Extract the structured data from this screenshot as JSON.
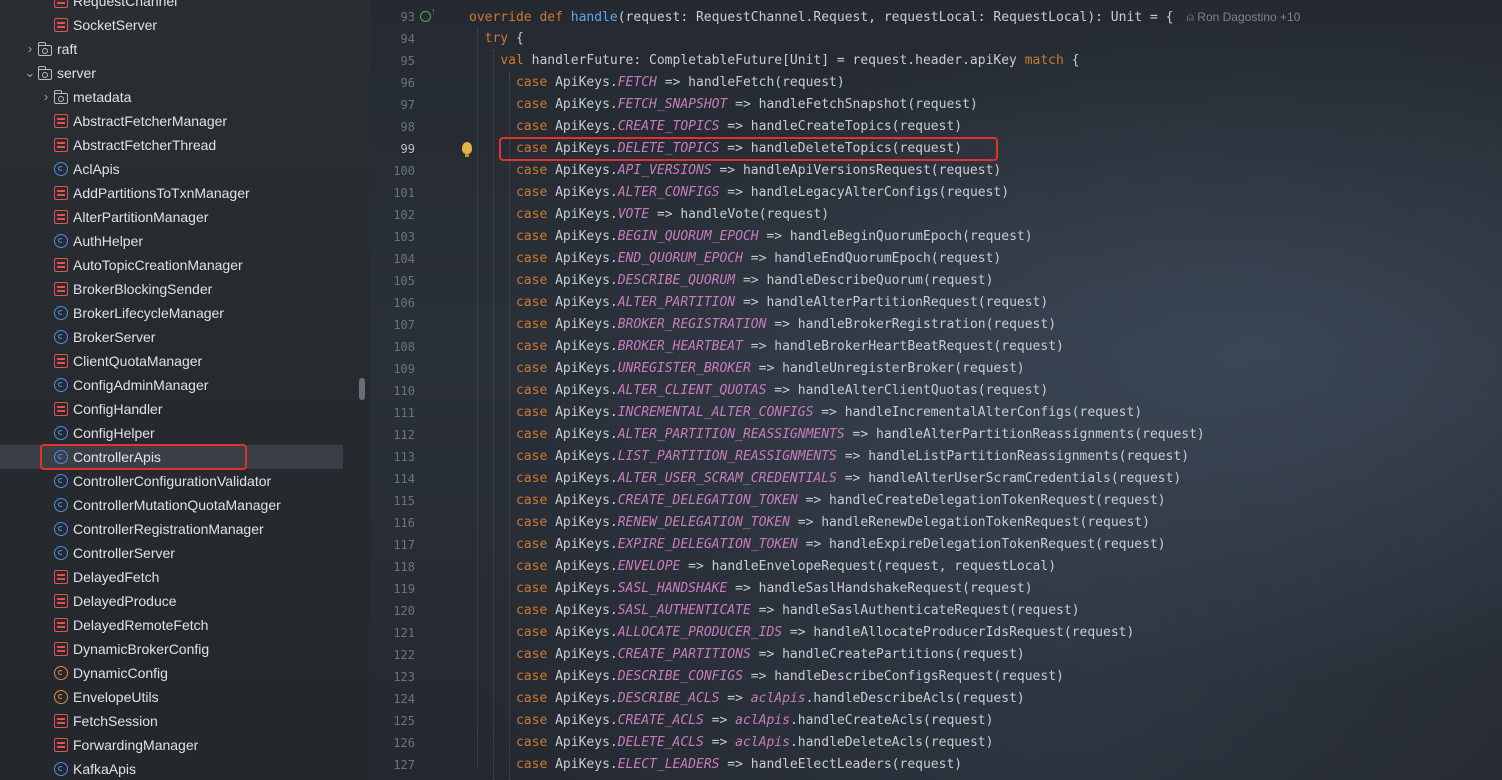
{
  "tree": {
    "items": [
      {
        "label": "RequestChannel",
        "icon": "scala-file-icon",
        "indent": 2
      },
      {
        "label": "SocketServer",
        "icon": "scala-file-icon",
        "indent": 2
      },
      {
        "label": "raft",
        "icon": "folder-icon",
        "indent": 1,
        "expander": "chevron-right-icon"
      },
      {
        "label": "server",
        "icon": "folder-icon",
        "indent": 1,
        "expander": "chevron-down-icon"
      },
      {
        "label": "metadata",
        "icon": "folder-icon",
        "indent": 2,
        "expander": "chevron-right-icon"
      },
      {
        "label": "AbstractFetcherManager",
        "icon": "scala-file-icon",
        "indent": 2
      },
      {
        "label": "AbstractFetcherThread",
        "icon": "scala-file-icon",
        "indent": 2
      },
      {
        "label": "AclApis",
        "icon": "class-icon",
        "indent": 2
      },
      {
        "label": "AddPartitionsToTxnManager",
        "icon": "scala-file-icon",
        "indent": 2
      },
      {
        "label": "AlterPartitionManager",
        "icon": "scala-file-icon",
        "indent": 2
      },
      {
        "label": "AuthHelper",
        "icon": "class-icon",
        "indent": 2
      },
      {
        "label": "AutoTopicCreationManager",
        "icon": "scala-file-icon",
        "indent": 2
      },
      {
        "label": "BrokerBlockingSender",
        "icon": "scala-file-icon",
        "indent": 2
      },
      {
        "label": "BrokerLifecycleManager",
        "icon": "class-icon",
        "indent": 2
      },
      {
        "label": "BrokerServer",
        "icon": "class-icon",
        "indent": 2
      },
      {
        "label": "ClientQuotaManager",
        "icon": "scala-file-icon",
        "indent": 2
      },
      {
        "label": "ConfigAdminManager",
        "icon": "class-icon",
        "indent": 2
      },
      {
        "label": "ConfigHandler",
        "icon": "scala-file-icon",
        "indent": 2
      },
      {
        "label": "ConfigHelper",
        "icon": "class-icon",
        "indent": 2
      },
      {
        "label": "ControllerApis",
        "icon": "class-icon",
        "indent": 2,
        "selected": true
      },
      {
        "label": "ControllerConfigurationValidator",
        "icon": "class-icon",
        "indent": 2
      },
      {
        "label": "ControllerMutationQuotaManager",
        "icon": "class-icon",
        "indent": 2
      },
      {
        "label": "ControllerRegistrationManager",
        "icon": "class-icon",
        "indent": 2
      },
      {
        "label": "ControllerServer",
        "icon": "class-icon",
        "indent": 2
      },
      {
        "label": "DelayedFetch",
        "icon": "scala-file-icon",
        "indent": 2
      },
      {
        "label": "DelayedProduce",
        "icon": "scala-file-icon",
        "indent": 2
      },
      {
        "label": "DelayedRemoteFetch",
        "icon": "scala-file-icon",
        "indent": 2
      },
      {
        "label": "DynamicBrokerConfig",
        "icon": "scala-file-icon",
        "indent": 2
      },
      {
        "label": "DynamicConfig",
        "icon": "object-icon",
        "indent": 2
      },
      {
        "label": "EnvelopeUtils",
        "icon": "object-icon",
        "indent": 2
      },
      {
        "label": "FetchSession",
        "icon": "scala-file-icon",
        "indent": 2
      },
      {
        "label": "ForwardingManager",
        "icon": "scala-file-icon",
        "indent": 2
      },
      {
        "label": "KafkaApis",
        "icon": "class-icon",
        "indent": 2
      }
    ]
  },
  "editor": {
    "author_hint": "Ron Dagostino +10",
    "current_line": "99",
    "lines": [
      {
        "n": "93",
        "tokens": [
          [
            "kw",
            "override def "
          ],
          [
            "fn",
            "handle"
          ],
          [
            "t",
            "(request: RequestChannel.Request, requestLocal: RequestLocal): Unit = {"
          ]
        ]
      },
      {
        "n": "94",
        "tokens": [
          [
            "t",
            "  "
          ],
          [
            "kw",
            "try"
          ],
          [
            "t",
            " {"
          ]
        ]
      },
      {
        "n": "95",
        "tokens": [
          [
            "t",
            "    "
          ],
          [
            "kw",
            "val"
          ],
          [
            "t",
            " handlerFuture: CompletableFuture[Unit] = request.header.apiKey "
          ],
          [
            "kw",
            "match"
          ],
          [
            "t",
            " {"
          ]
        ]
      },
      {
        "n": "96",
        "case": "FETCH",
        "rest": " => handleFetch(request)"
      },
      {
        "n": "97",
        "case": "FETCH_SNAPSHOT",
        "rest": " => handleFetchSnapshot(request)"
      },
      {
        "n": "98",
        "case": "CREATE_TOPICS",
        "rest": " => handleCreateTopics(request)"
      },
      {
        "n": "99",
        "case": "DELETE_TOPICS",
        "rest": " => handleDeleteTopics(request)"
      },
      {
        "n": "100",
        "case": "API_VERSIONS",
        "rest": " => handleApiVersionsRequest(request)"
      },
      {
        "n": "101",
        "case": "ALTER_CONFIGS",
        "rest": " => handleLegacyAlterConfigs(request)"
      },
      {
        "n": "102",
        "case": "VOTE",
        "rest": " => handleVote(request)"
      },
      {
        "n": "103",
        "case": "BEGIN_QUORUM_EPOCH",
        "rest": " => handleBeginQuorumEpoch(request)"
      },
      {
        "n": "104",
        "case": "END_QUORUM_EPOCH",
        "rest": " => handleEndQuorumEpoch(request)"
      },
      {
        "n": "105",
        "case": "DESCRIBE_QUORUM",
        "rest": " => handleDescribeQuorum(request)"
      },
      {
        "n": "106",
        "case": "ALTER_PARTITION",
        "rest": " => handleAlterPartitionRequest(request)"
      },
      {
        "n": "107",
        "case": "BROKER_REGISTRATION",
        "rest": " => handleBrokerRegistration(request)"
      },
      {
        "n": "108",
        "case": "BROKER_HEARTBEAT",
        "rest": " => handleBrokerHeartBeatRequest(request)"
      },
      {
        "n": "109",
        "case": "UNREGISTER_BROKER",
        "rest": " => handleUnregisterBroker(request)"
      },
      {
        "n": "110",
        "case": "ALTER_CLIENT_QUOTAS",
        "rest": " => handleAlterClientQuotas(request)"
      },
      {
        "n": "111",
        "case": "INCREMENTAL_ALTER_CONFIGS",
        "rest": " => handleIncrementalAlterConfigs(request)"
      },
      {
        "n": "112",
        "case": "ALTER_PARTITION_REASSIGNMENTS",
        "rest": " => handleAlterPartitionReassignments(request)"
      },
      {
        "n": "113",
        "case": "LIST_PARTITION_REASSIGNMENTS",
        "rest": " => handleListPartitionReassignments(request)"
      },
      {
        "n": "114",
        "case": "ALTER_USER_SCRAM_CREDENTIALS",
        "rest": " => handleAlterUserScramCredentials(request)"
      },
      {
        "n": "115",
        "case": "CREATE_DELEGATION_TOKEN",
        "rest": " => handleCreateDelegationTokenRequest(request)"
      },
      {
        "n": "116",
        "case": "RENEW_DELEGATION_TOKEN",
        "rest": " => handleRenewDelegationTokenRequest(request)"
      },
      {
        "n": "117",
        "case": "EXPIRE_DELEGATION_TOKEN",
        "rest": " => handleExpireDelegationTokenRequest(request)"
      },
      {
        "n": "118",
        "case": "ENVELOPE",
        "rest": " => handleEnvelopeRequest(request, requestLocal)"
      },
      {
        "n": "119",
        "case": "SASL_HANDSHAKE",
        "rest": " => handleSaslHandshakeRequest(request)"
      },
      {
        "n": "120",
        "case": "SASL_AUTHENTICATE",
        "rest": " => handleSaslAuthenticateRequest(request)"
      },
      {
        "n": "121",
        "case": "ALLOCATE_PRODUCER_IDS",
        "rest": " => handleAllocateProducerIdsRequest(request)"
      },
      {
        "n": "122",
        "case": "CREATE_PARTITIONS",
        "rest": " => handleCreatePartitions(request)"
      },
      {
        "n": "123",
        "case": "DESCRIBE_CONFIGS",
        "rest": " => handleDescribeConfigsRequest(request)"
      },
      {
        "n": "124",
        "case": "DESCRIBE_ACLS",
        "acl": true,
        "rest": ".handleDescribeAcls(request)"
      },
      {
        "n": "125",
        "case": "CREATE_ACLS",
        "acl": true,
        "rest": ".handleCreateAcls(request)"
      },
      {
        "n": "126",
        "case": "DELETE_ACLS",
        "acl": true,
        "rest": ".handleDeleteAcls(request)"
      },
      {
        "n": "127",
        "case": "ELECT_LEADERS",
        "rest": " => handleElectLeaders(request)"
      }
    ],
    "case_keyword": "case",
    "apikeys_prefix": "ApiKeys.",
    "acl_object": "aclApis",
    "arrow": " => "
  },
  "colors": {
    "keyword": "#cc7832",
    "function": "#5fa8e8",
    "constant": "#c77dbb",
    "highlight_box": "#e2322f"
  }
}
